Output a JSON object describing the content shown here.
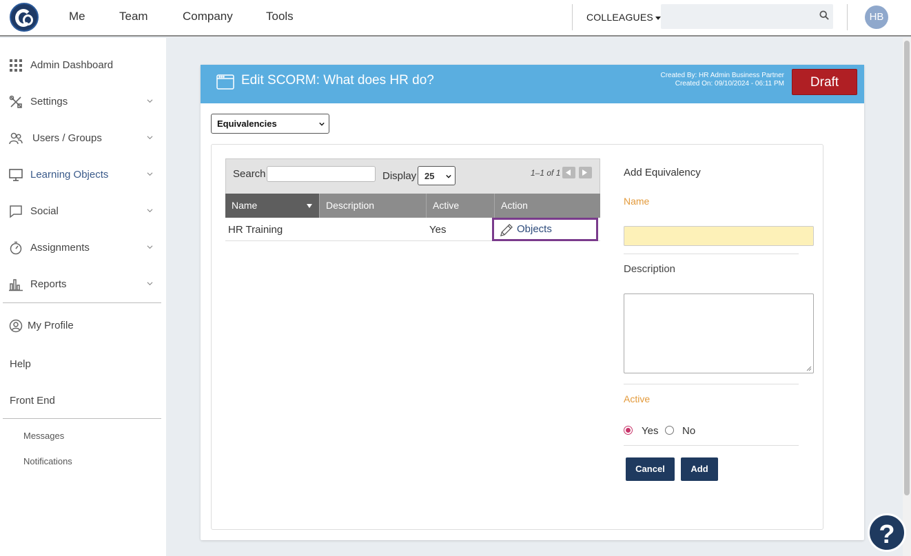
{
  "topnav": {
    "links": [
      "Me",
      "Team",
      "Company",
      "Tools"
    ],
    "colleagues_label": "COLLEAGUES",
    "search_value": "",
    "avatar_initials": "HB"
  },
  "sidebar": {
    "items": [
      {
        "label": "Admin Dashboard",
        "icon": "grid-icon",
        "expandable": false
      },
      {
        "label": "Settings",
        "icon": "tools-icon",
        "expandable": true
      },
      {
        "label": "Users / Groups",
        "icon": "users-icon",
        "expandable": true
      },
      {
        "label": "Learning Objects",
        "icon": "monitor-icon",
        "expandable": true,
        "active": true
      },
      {
        "label": "Social",
        "icon": "chat-icon",
        "expandable": true
      },
      {
        "label": "Assignments",
        "icon": "stopwatch-icon",
        "expandable": true
      },
      {
        "label": "Reports",
        "icon": "bar-chart-icon",
        "expandable": true
      }
    ],
    "my_profile": "My Profile",
    "help": "Help",
    "front_end": "Front End",
    "messages": "Messages",
    "notifications": "Notifications"
  },
  "card": {
    "title": "Edit SCORM: What does HR do?",
    "created_by": "Created By: HR Admin Business Partner",
    "created_on": "Created On: 09/10/2024 - 06:11 PM",
    "status": "Draft",
    "status_color": "#b01f24",
    "header_color": "#5aaee0",
    "section_select": "Equivalencies"
  },
  "grid": {
    "search_label": "Search",
    "search_value": "",
    "display_label": "Display",
    "display_value": "25",
    "pager_text": "1–1 of 1",
    "columns": [
      "Name",
      "Description",
      "Active",
      "Action"
    ],
    "rows": [
      {
        "name": "HR Training",
        "description": "",
        "active": "Yes",
        "action": "Objects"
      }
    ]
  },
  "form": {
    "title": "Add Equivalency",
    "name_label": "Name",
    "name_value": "",
    "description_label": "Description",
    "description_value": "",
    "active_label": "Active",
    "active_options": [
      "Yes",
      "No"
    ],
    "active_selected": "Yes",
    "cancel_label": "Cancel",
    "add_label": "Add"
  },
  "help_bubble": "?"
}
